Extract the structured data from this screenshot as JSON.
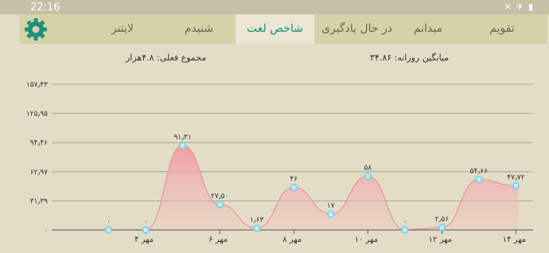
{
  "status": {
    "time": "22:16",
    "icons": [
      "mute-icon",
      "airplane-icon",
      "battery-icon"
    ]
  },
  "tabs": [
    {
      "label": "تقویم",
      "active": false
    },
    {
      "label": "میدانم",
      "active": false
    },
    {
      "label": "در حال یادگیری",
      "active": false
    },
    {
      "label": "شاخص لغت",
      "active": true
    },
    {
      "label": "شنیدم",
      "active": false
    },
    {
      "label": "لایتنر",
      "active": false
    }
  ],
  "stats": {
    "average": "میانگین روزانه: ۳۴.۸۶",
    "total": "مجموع فعلی: ۴.۸هزار"
  },
  "colors": {
    "accent": "#1f8f7c",
    "tabbar": "#d6d2a8",
    "active_tab": "#ece7d3",
    "background": "#e3ddc7",
    "area": "#f2a2a8",
    "point": "#a8e6f5"
  },
  "chart_data": {
    "type": "area",
    "y_ticks": [
      "۰",
      "۳۱٫۳۹",
      "۶۲٫۹۷",
      "۹۴٫۴۶",
      "۱۲۵٫۹۵",
      "۱۵۷٫۴۳"
    ],
    "y_values": [
      0,
      31.49,
      62.97,
      94.46,
      125.95,
      157.43
    ],
    "ylim": [
      0,
      157.43
    ],
    "x_ticks": [
      {
        "x": 3,
        "label": "۴ مهر"
      },
      {
        "x": 5,
        "label": "۶ مهر"
      },
      {
        "x": 7,
        "label": "۸ مهر"
      },
      {
        "x": 9,
        "label": "۱۰ مهر"
      },
      {
        "x": 11,
        "label": "۱۲ مهر"
      },
      {
        "x": 13,
        "label": "۱۴ مهر"
      }
    ],
    "xlim": [
      1,
      14
    ],
    "points": [
      {
        "x": 2,
        "y": 0,
        "label": "۰"
      },
      {
        "x": 3,
        "y": 0,
        "label": "۰"
      },
      {
        "x": 4,
        "y": 91.31,
        "label": "۹۱٫۳۱"
      },
      {
        "x": 5,
        "y": 27.5,
        "label": "۲۷٫۵۰"
      },
      {
        "x": 6,
        "y": 1.63,
        "label": "۱٫۶۳"
      },
      {
        "x": 7,
        "y": 46,
        "label": "۴۶"
      },
      {
        "x": 8,
        "y": 17,
        "label": "۱۷"
      },
      {
        "x": 9,
        "y": 58,
        "label": "۵۸"
      },
      {
        "x": 10,
        "y": 0,
        "label": "۰"
      },
      {
        "x": 11,
        "y": 2.56,
        "label": "۲٫۵۶"
      },
      {
        "x": 12,
        "y": 54.66,
        "label": "۵۴٫۶۶"
      },
      {
        "x": 13,
        "y": 47.72,
        "label": "۴۷٫۷۲"
      }
    ],
    "grid": true
  }
}
